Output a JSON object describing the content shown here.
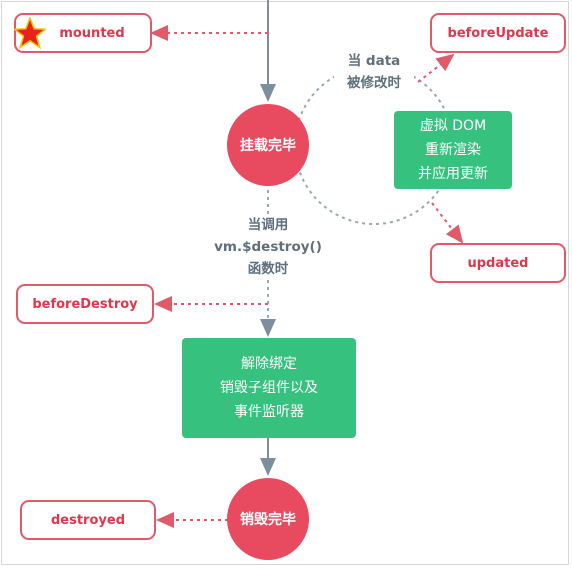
{
  "hooks": {
    "mounted": "mounted",
    "before_update": "beforeUpdate",
    "updated": "updated",
    "before_destroy": "beforeDestroy",
    "destroyed": "destroyed"
  },
  "circles": {
    "mounted_done": "挂载完毕",
    "destroy_done": "销毁完毕"
  },
  "update_loop": {
    "trigger_line1": "当 data",
    "trigger_line2": "被修改时",
    "vdom_line1": "虚拟 DOM",
    "vdom_line2": "重新渲染",
    "vdom_line3": "并应用更新"
  },
  "destroy_trigger": {
    "line1": "当调用",
    "line2": "vm.$destroy()",
    "line3": "函数时"
  },
  "teardown": {
    "line1": "解除绑定",
    "line2": "销毁子组件以及",
    "line3": "事件监听器"
  },
  "colors": {
    "hook_red": "#e0364b",
    "circle_red": "#e84a5f",
    "box_green": "#36c27e",
    "flow_gray": "#7d8f9c",
    "star": "#e8231c"
  },
  "icons": {
    "marker": "star-icon"
  }
}
